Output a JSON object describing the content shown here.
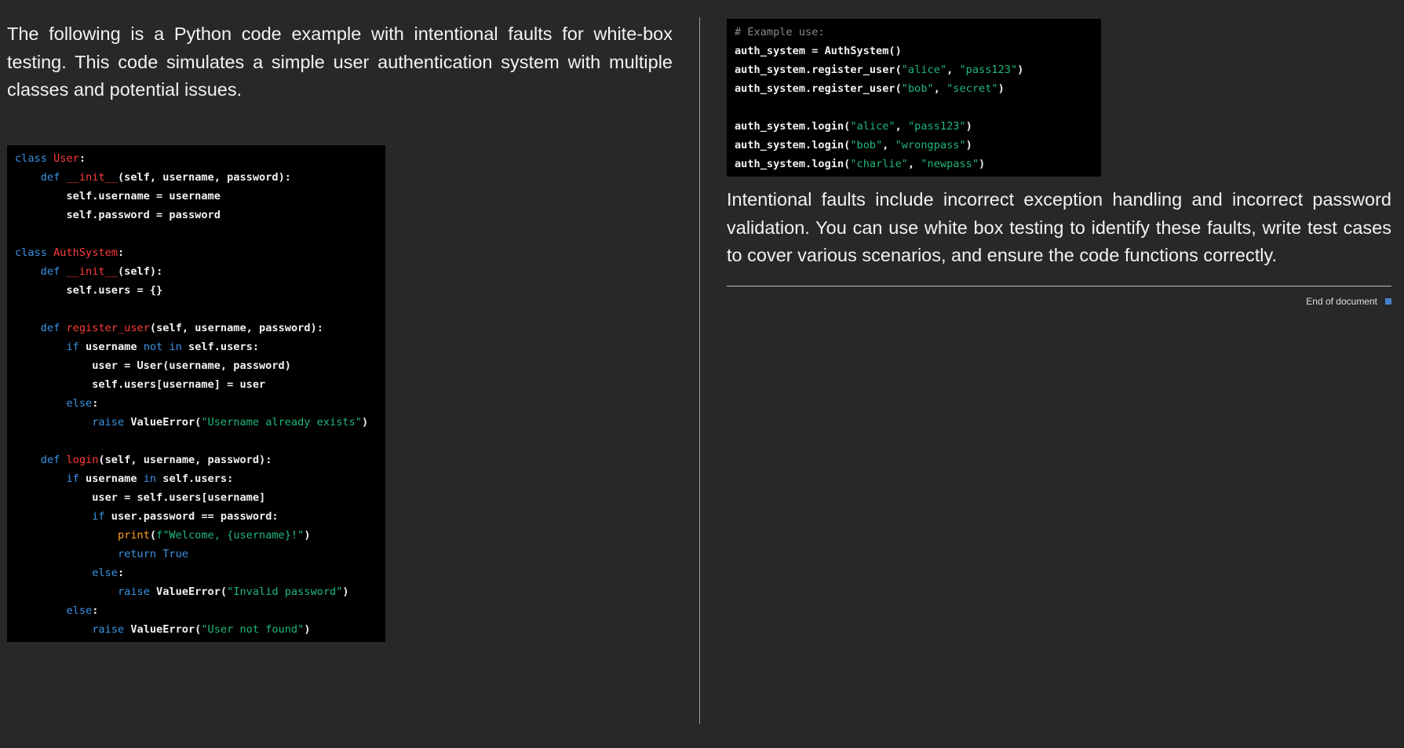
{
  "left": {
    "intro": "The following is a Python code example with intentional faults for white-box testing. This code simulates a simple user authentication system with multiple classes and potential issues.",
    "code": [
      [
        [
          "kw",
          "class "
        ],
        [
          "cls",
          "User"
        ],
        [
          "t",
          ":"
        ]
      ],
      [
        [
          "t",
          "    "
        ],
        [
          "kw",
          "def "
        ],
        [
          "fn",
          "__init__"
        ],
        [
          "t",
          "(self, username, password):"
        ]
      ],
      [
        [
          "t",
          "        self.username = username"
        ]
      ],
      [
        [
          "t",
          "        self.password = password"
        ]
      ],
      [],
      [
        [
          "kw",
          "class "
        ],
        [
          "cls",
          "AuthSystem"
        ],
        [
          "t",
          ":"
        ]
      ],
      [
        [
          "t",
          "    "
        ],
        [
          "kw",
          "def "
        ],
        [
          "fn",
          "__init__"
        ],
        [
          "t",
          "(self):"
        ]
      ],
      [
        [
          "t",
          "        self.users = {}"
        ]
      ],
      [],
      [
        [
          "t",
          "    "
        ],
        [
          "kw",
          "def "
        ],
        [
          "fn",
          "register_user"
        ],
        [
          "t",
          "(self, username, password):"
        ]
      ],
      [
        [
          "t",
          "        "
        ],
        [
          "kw",
          "if"
        ],
        [
          "t",
          " username "
        ],
        [
          "kw",
          "not in"
        ],
        [
          "t",
          " self.users:"
        ]
      ],
      [
        [
          "t",
          "            user = User(username, password)"
        ]
      ],
      [
        [
          "t",
          "            self.users[username] = user"
        ]
      ],
      [
        [
          "t",
          "        "
        ],
        [
          "kw",
          "else"
        ],
        [
          "t",
          ":"
        ]
      ],
      [
        [
          "t",
          "            "
        ],
        [
          "kw",
          "raise"
        ],
        [
          "t",
          " ValueError("
        ],
        [
          "str",
          "\"Username already exists\""
        ],
        [
          "t",
          ")"
        ]
      ],
      [],
      [
        [
          "t",
          "    "
        ],
        [
          "kw",
          "def "
        ],
        [
          "fn",
          "login"
        ],
        [
          "t",
          "(self, username, password):"
        ]
      ],
      [
        [
          "t",
          "        "
        ],
        [
          "kw",
          "if"
        ],
        [
          "t",
          " username "
        ],
        [
          "kw",
          "in"
        ],
        [
          "t",
          " self.users:"
        ]
      ],
      [
        [
          "t",
          "            user = self.users[username]"
        ]
      ],
      [
        [
          "t",
          "            "
        ],
        [
          "kw",
          "if"
        ],
        [
          "t",
          " user.password == password:"
        ]
      ],
      [
        [
          "t",
          "                "
        ],
        [
          "builtin",
          "print"
        ],
        [
          "t",
          "("
        ],
        [
          "str",
          "f\"Welcome, {username}!\""
        ],
        [
          "t",
          ")"
        ]
      ],
      [
        [
          "t",
          "                "
        ],
        [
          "kw",
          "return True"
        ]
      ],
      [
        [
          "t",
          "            "
        ],
        [
          "kw",
          "else"
        ],
        [
          "t",
          ":"
        ]
      ],
      [
        [
          "t",
          "                "
        ],
        [
          "kw",
          "raise"
        ],
        [
          "t",
          " ValueError("
        ],
        [
          "str",
          "\"Invalid password\""
        ],
        [
          "t",
          ")"
        ]
      ],
      [
        [
          "t",
          "        "
        ],
        [
          "kw",
          "else"
        ],
        [
          "t",
          ":"
        ]
      ],
      [
        [
          "t",
          "            "
        ],
        [
          "kw",
          "raise"
        ],
        [
          "t",
          " ValueError("
        ],
        [
          "str",
          "\"User not found\""
        ],
        [
          "t",
          ")"
        ]
      ]
    ]
  },
  "right": {
    "code": [
      [
        [
          "comment",
          "# Example use:"
        ]
      ],
      [
        [
          "t",
          "auth_system = AuthSystem()"
        ]
      ],
      [
        [
          "t",
          "auth_system.register_user("
        ],
        [
          "str",
          "\"alice\""
        ],
        [
          "t",
          ", "
        ],
        [
          "str",
          "\"pass123\""
        ],
        [
          "t",
          ")"
        ]
      ],
      [
        [
          "t",
          "auth_system.register_user("
        ],
        [
          "str",
          "\"bob\""
        ],
        [
          "t",
          ", "
        ],
        [
          "str",
          "\"secret\""
        ],
        [
          "t",
          ")"
        ]
      ],
      [],
      [
        [
          "t",
          "auth_system.login("
        ],
        [
          "str",
          "\"alice\""
        ],
        [
          "t",
          ", "
        ],
        [
          "str",
          "\"pass123\""
        ],
        [
          "t",
          ")"
        ]
      ],
      [
        [
          "t",
          "auth_system.login("
        ],
        [
          "str",
          "\"bob\""
        ],
        [
          "t",
          ", "
        ],
        [
          "str",
          "\"wrongpass\""
        ],
        [
          "t",
          ")"
        ]
      ],
      [
        [
          "t",
          "auth_system.login("
        ],
        [
          "str",
          "\"charlie\""
        ],
        [
          "t",
          ", "
        ],
        [
          "str",
          "\"newpass\""
        ],
        [
          "t",
          ")"
        ]
      ]
    ],
    "conclusion": "Intentional faults include incorrect exception handling and incorrect password validation. You can use white box testing to identify these faults, write test cases to cover various scenarios, and ensure the code functions correctly.",
    "end_label": "End of document"
  },
  "colors": {
    "background": "#282828",
    "code_background": "#000000",
    "keyword": "#3b93e6",
    "class_function": "#ff3b3b",
    "string": "#1fb878",
    "builtin": "#ff9e1f",
    "comment": "#8a8a8a",
    "end_marker": "#4a7fd0"
  }
}
